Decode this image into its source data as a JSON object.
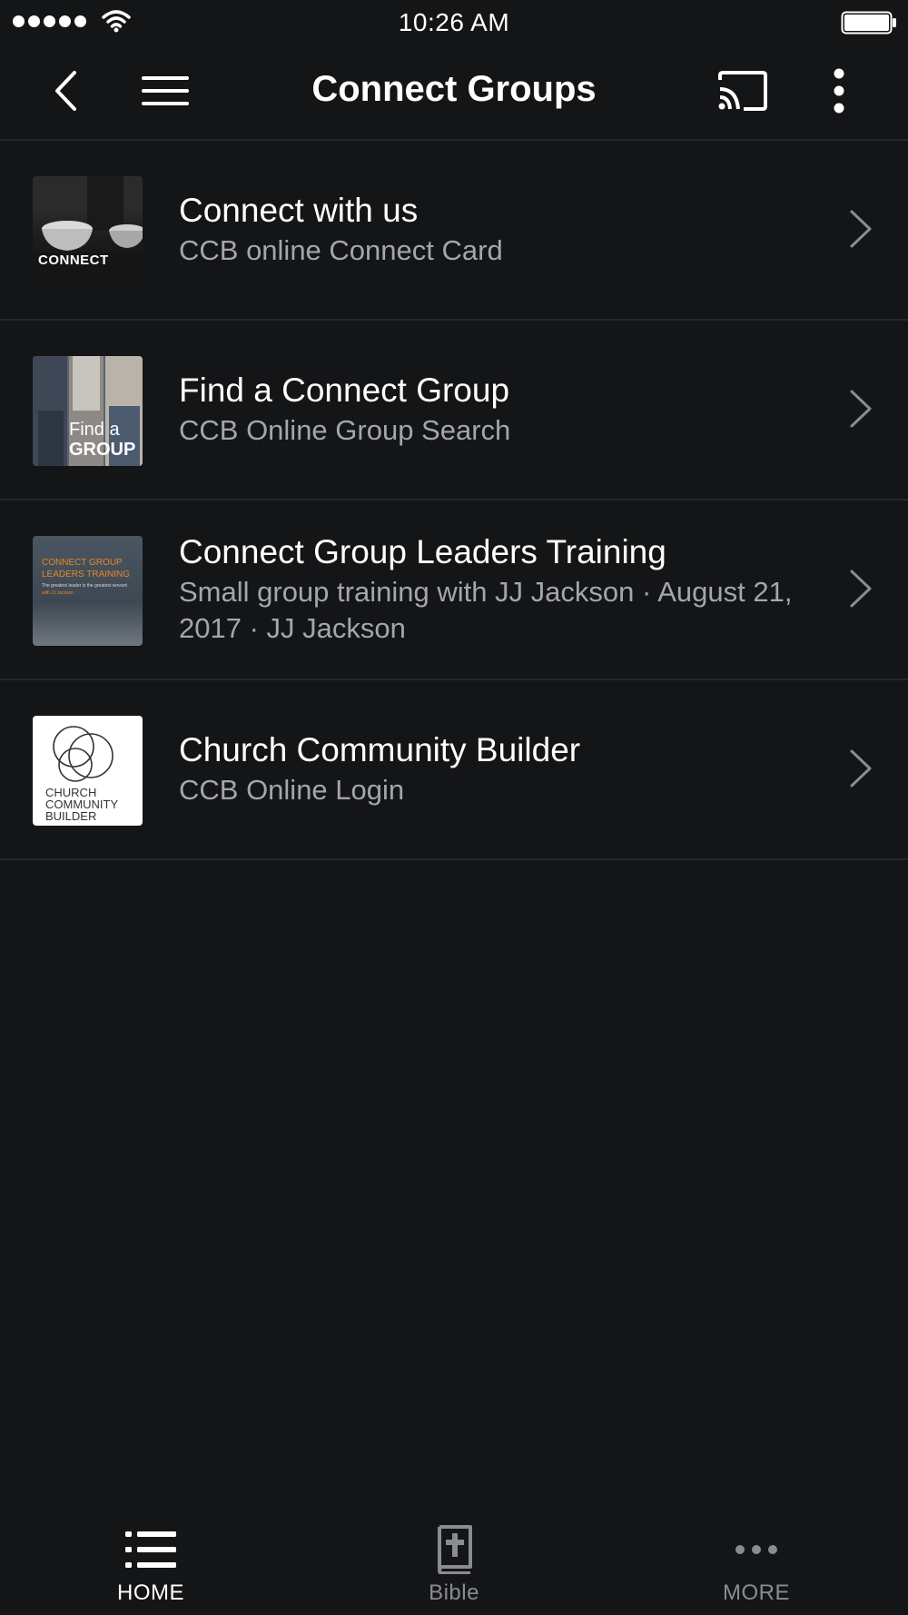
{
  "status_bar": {
    "time": "10:26 AM"
  },
  "nav": {
    "title": "Connect Groups"
  },
  "items": [
    {
      "title": "Connect with us",
      "subtitle": "CCB online Connect Card",
      "thumb_caption": "CONNECT"
    },
    {
      "title": "Find a Connect Group",
      "subtitle": "CCB Online Group Search",
      "thumb_caption_line1": "Find a",
      "thumb_caption_line2": "GROUP"
    },
    {
      "title": "Connect Group Leaders Training",
      "subtitle": "Small group training with JJ Jackson · August 21, 2017 · JJ Jackson",
      "thumb_caption_line1": "CONNECT GROUP",
      "thumb_caption_line2": "LEADERS TRAINING",
      "thumb_caption_line3": "The greatest leader is the greatest servant",
      "thumb_caption_line4": "with JJ Jackson"
    },
    {
      "title": "Church Community Builder",
      "subtitle": "CCB Online Login",
      "thumb_caption_line1": "CHURCH",
      "thumb_caption_line2": "COMMUNITY",
      "thumb_caption_line3": "BUILDER"
    }
  ],
  "tabs": [
    {
      "label": "HOME",
      "icon": "list-icon",
      "active": true
    },
    {
      "label": "Bible",
      "icon": "bible-icon",
      "active": false
    },
    {
      "label": "MORE",
      "icon": "ellipsis-icon",
      "active": false
    }
  ],
  "colors": {
    "background": "#141517",
    "divider": "#25272b",
    "subtitle": "#a4a6aa",
    "inactive_tab": "#8a8c90",
    "training_orange": "#e8862a"
  }
}
